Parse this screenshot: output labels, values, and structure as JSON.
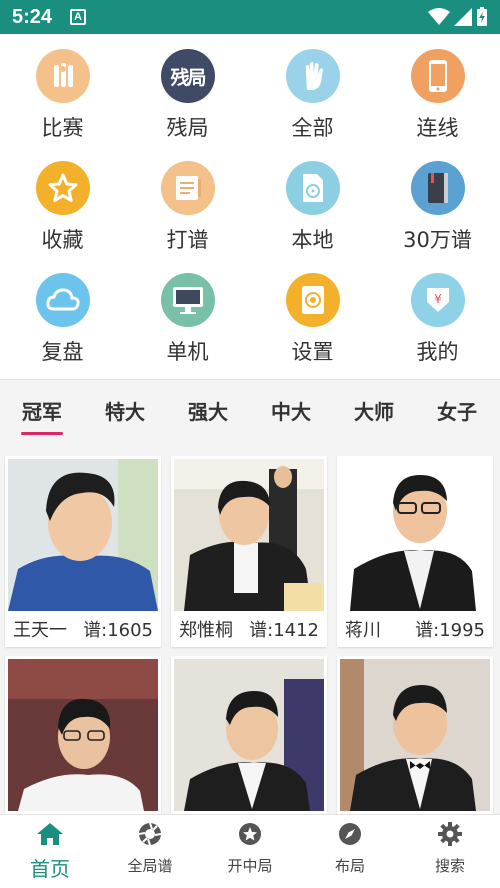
{
  "status_bar": {
    "time": "5:24",
    "notification_letter": "A"
  },
  "colors": {
    "status_bar": "#1a8f7f",
    "accent": "#1a8f7f",
    "tab_indicator": "#e0266a"
  },
  "grid": [
    {
      "label": "比赛",
      "icon": "trophy-icon",
      "color": "#f5c18a"
    },
    {
      "label": "残局",
      "icon": "endgame-icon",
      "color": "#3f4a67",
      "glyph": "残局"
    },
    {
      "label": "全部",
      "icon": "hand-icon",
      "color": "#9ad2ea"
    },
    {
      "label": "连线",
      "icon": "phone-icon",
      "color": "#f0a061"
    },
    {
      "label": "收藏",
      "icon": "star-icon",
      "color": "#f3b12b"
    },
    {
      "label": "打谱",
      "icon": "notebook-icon",
      "color": "#f5c18a"
    },
    {
      "label": "本地",
      "icon": "local-disk-icon",
      "color": "#8ccfe3"
    },
    {
      "label": "30万谱",
      "icon": "book-icon",
      "color": "#5ba2d2"
    },
    {
      "label": "复盘",
      "icon": "cloud-icon",
      "color": "#6cc3ec"
    },
    {
      "label": "单机",
      "icon": "monitor-icon",
      "color": "#79c0a8"
    },
    {
      "label": "设置",
      "icon": "settings-icon",
      "color": "#f3b12b"
    },
    {
      "label": "我的",
      "icon": "wallet-icon",
      "color": "#8fd2e8"
    }
  ],
  "tabs": [
    "冠军",
    "特大",
    "强大",
    "中大",
    "大师",
    "女子"
  ],
  "players": [
    {
      "name": "王天一",
      "count": "谱:1605"
    },
    {
      "name": "郑惟桐",
      "count": "谱:1412"
    },
    {
      "name": "蒋川",
      "count": "谱:1995"
    },
    {
      "name": "",
      "count": ""
    },
    {
      "name": "",
      "count": ""
    },
    {
      "name": "",
      "count": ""
    }
  ],
  "bottom_nav": [
    {
      "label": "首页",
      "icon": "home-icon"
    },
    {
      "label": "全局谱",
      "icon": "aperture-icon"
    },
    {
      "label": "开中局",
      "icon": "star-circle-icon"
    },
    {
      "label": "布局",
      "icon": "compass-icon"
    },
    {
      "label": "搜索",
      "icon": "gear-icon"
    }
  ]
}
